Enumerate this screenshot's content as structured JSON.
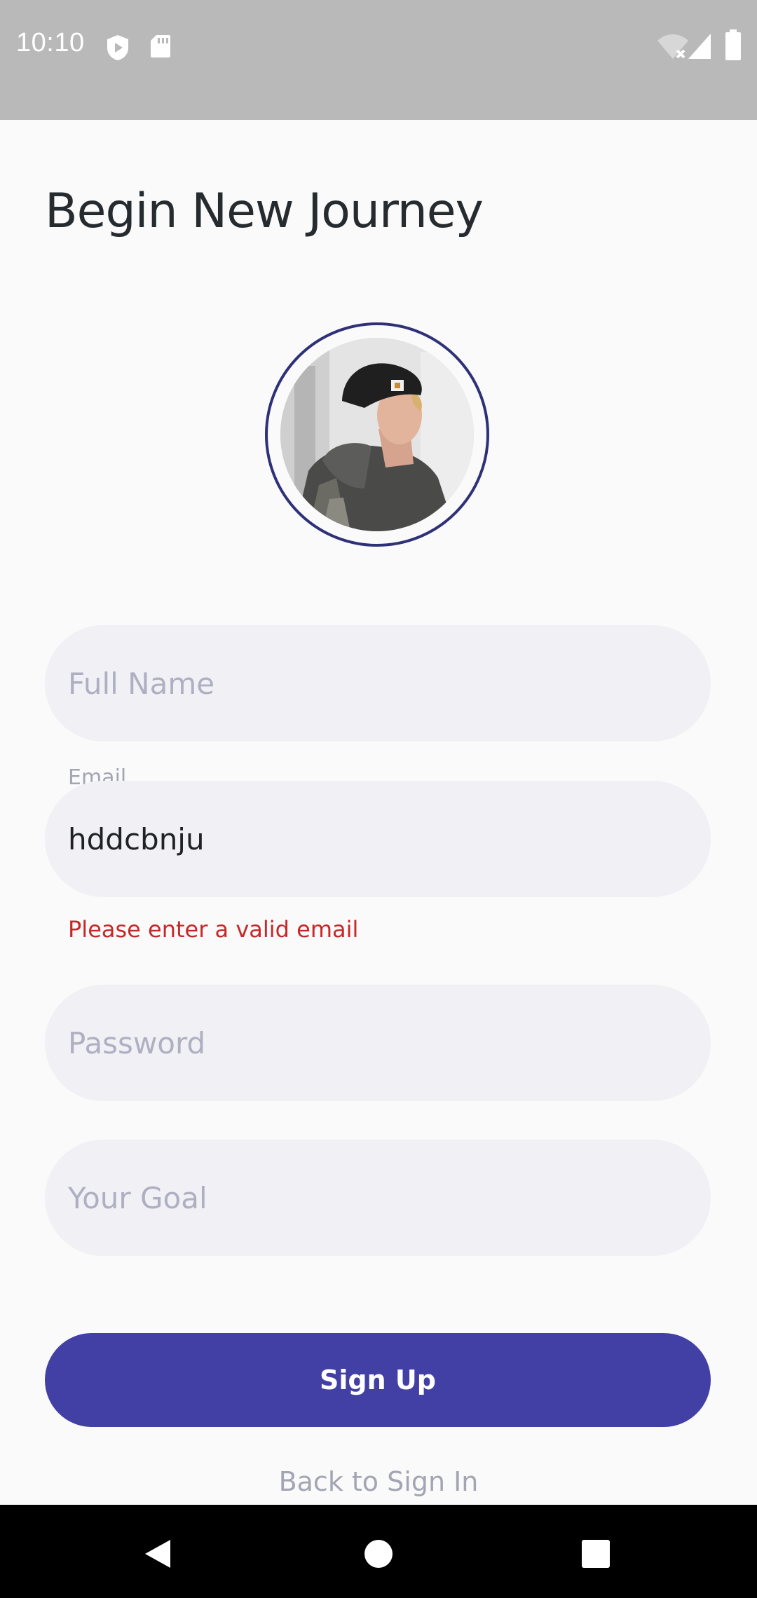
{
  "status_bar": {
    "time": "10:10",
    "icons": [
      "shield-play-icon",
      "sd-card-icon",
      "wifi-off-icon",
      "signal-icon",
      "battery-icon"
    ]
  },
  "page": {
    "title": "Begin New Journey"
  },
  "avatar": {
    "icon": "profile-photo",
    "ring_color": "#2e3177"
  },
  "form": {
    "full_name": {
      "placeholder": "Full Name",
      "value": ""
    },
    "email": {
      "label": "Email",
      "value": "hddcbnju",
      "error": "Please enter a valid email"
    },
    "password": {
      "placeholder": "Password",
      "value": ""
    },
    "goal": {
      "placeholder": "Your Goal",
      "value": ""
    }
  },
  "actions": {
    "signup_label": "Sign Up",
    "back_label": "Back to Sign In"
  },
  "colors": {
    "primary": "#4240a5",
    "error": "#c62828",
    "field_bg": "#f0f0f5",
    "status_bar": "#b9b9b9"
  },
  "nav_bar": {
    "icons": [
      "back-icon",
      "home-icon",
      "recents-icon"
    ]
  }
}
